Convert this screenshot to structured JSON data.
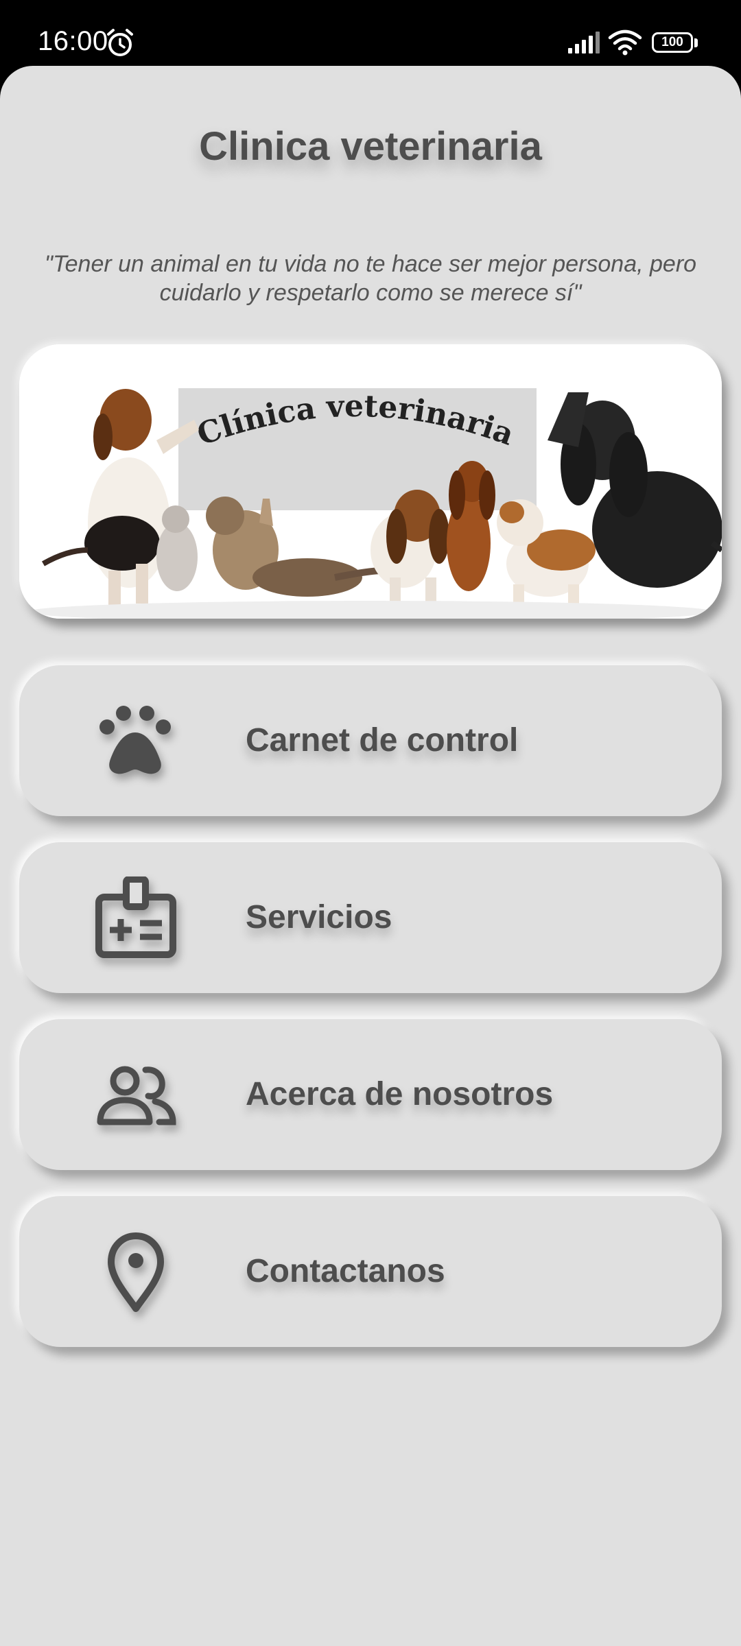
{
  "status_bar": {
    "time": "16:00",
    "battery": "100",
    "icons": [
      "alarm-icon",
      "signal-icon",
      "wifi-icon",
      "battery-icon"
    ]
  },
  "header": {
    "title": "Clinica veterinaria",
    "quote": "\"Tener un animal en tu vida no te hace ser mejor persona, pero cuidarlo y respetarlo como se merece sí\""
  },
  "banner": {
    "sign_text": "Clínica veterinaria"
  },
  "menu": {
    "items": [
      {
        "label": "Carnet de control",
        "icon": "paw-icon"
      },
      {
        "label": "Servicios",
        "icon": "id-badge-icon"
      },
      {
        "label": "Acerca de nosotros",
        "icon": "people-icon"
      },
      {
        "label": "Contactanos",
        "icon": "location-pin-icon"
      }
    ]
  },
  "colors": {
    "background": "#e0e0e0",
    "text": "#4d4d4d",
    "status_bar": "#000000"
  }
}
